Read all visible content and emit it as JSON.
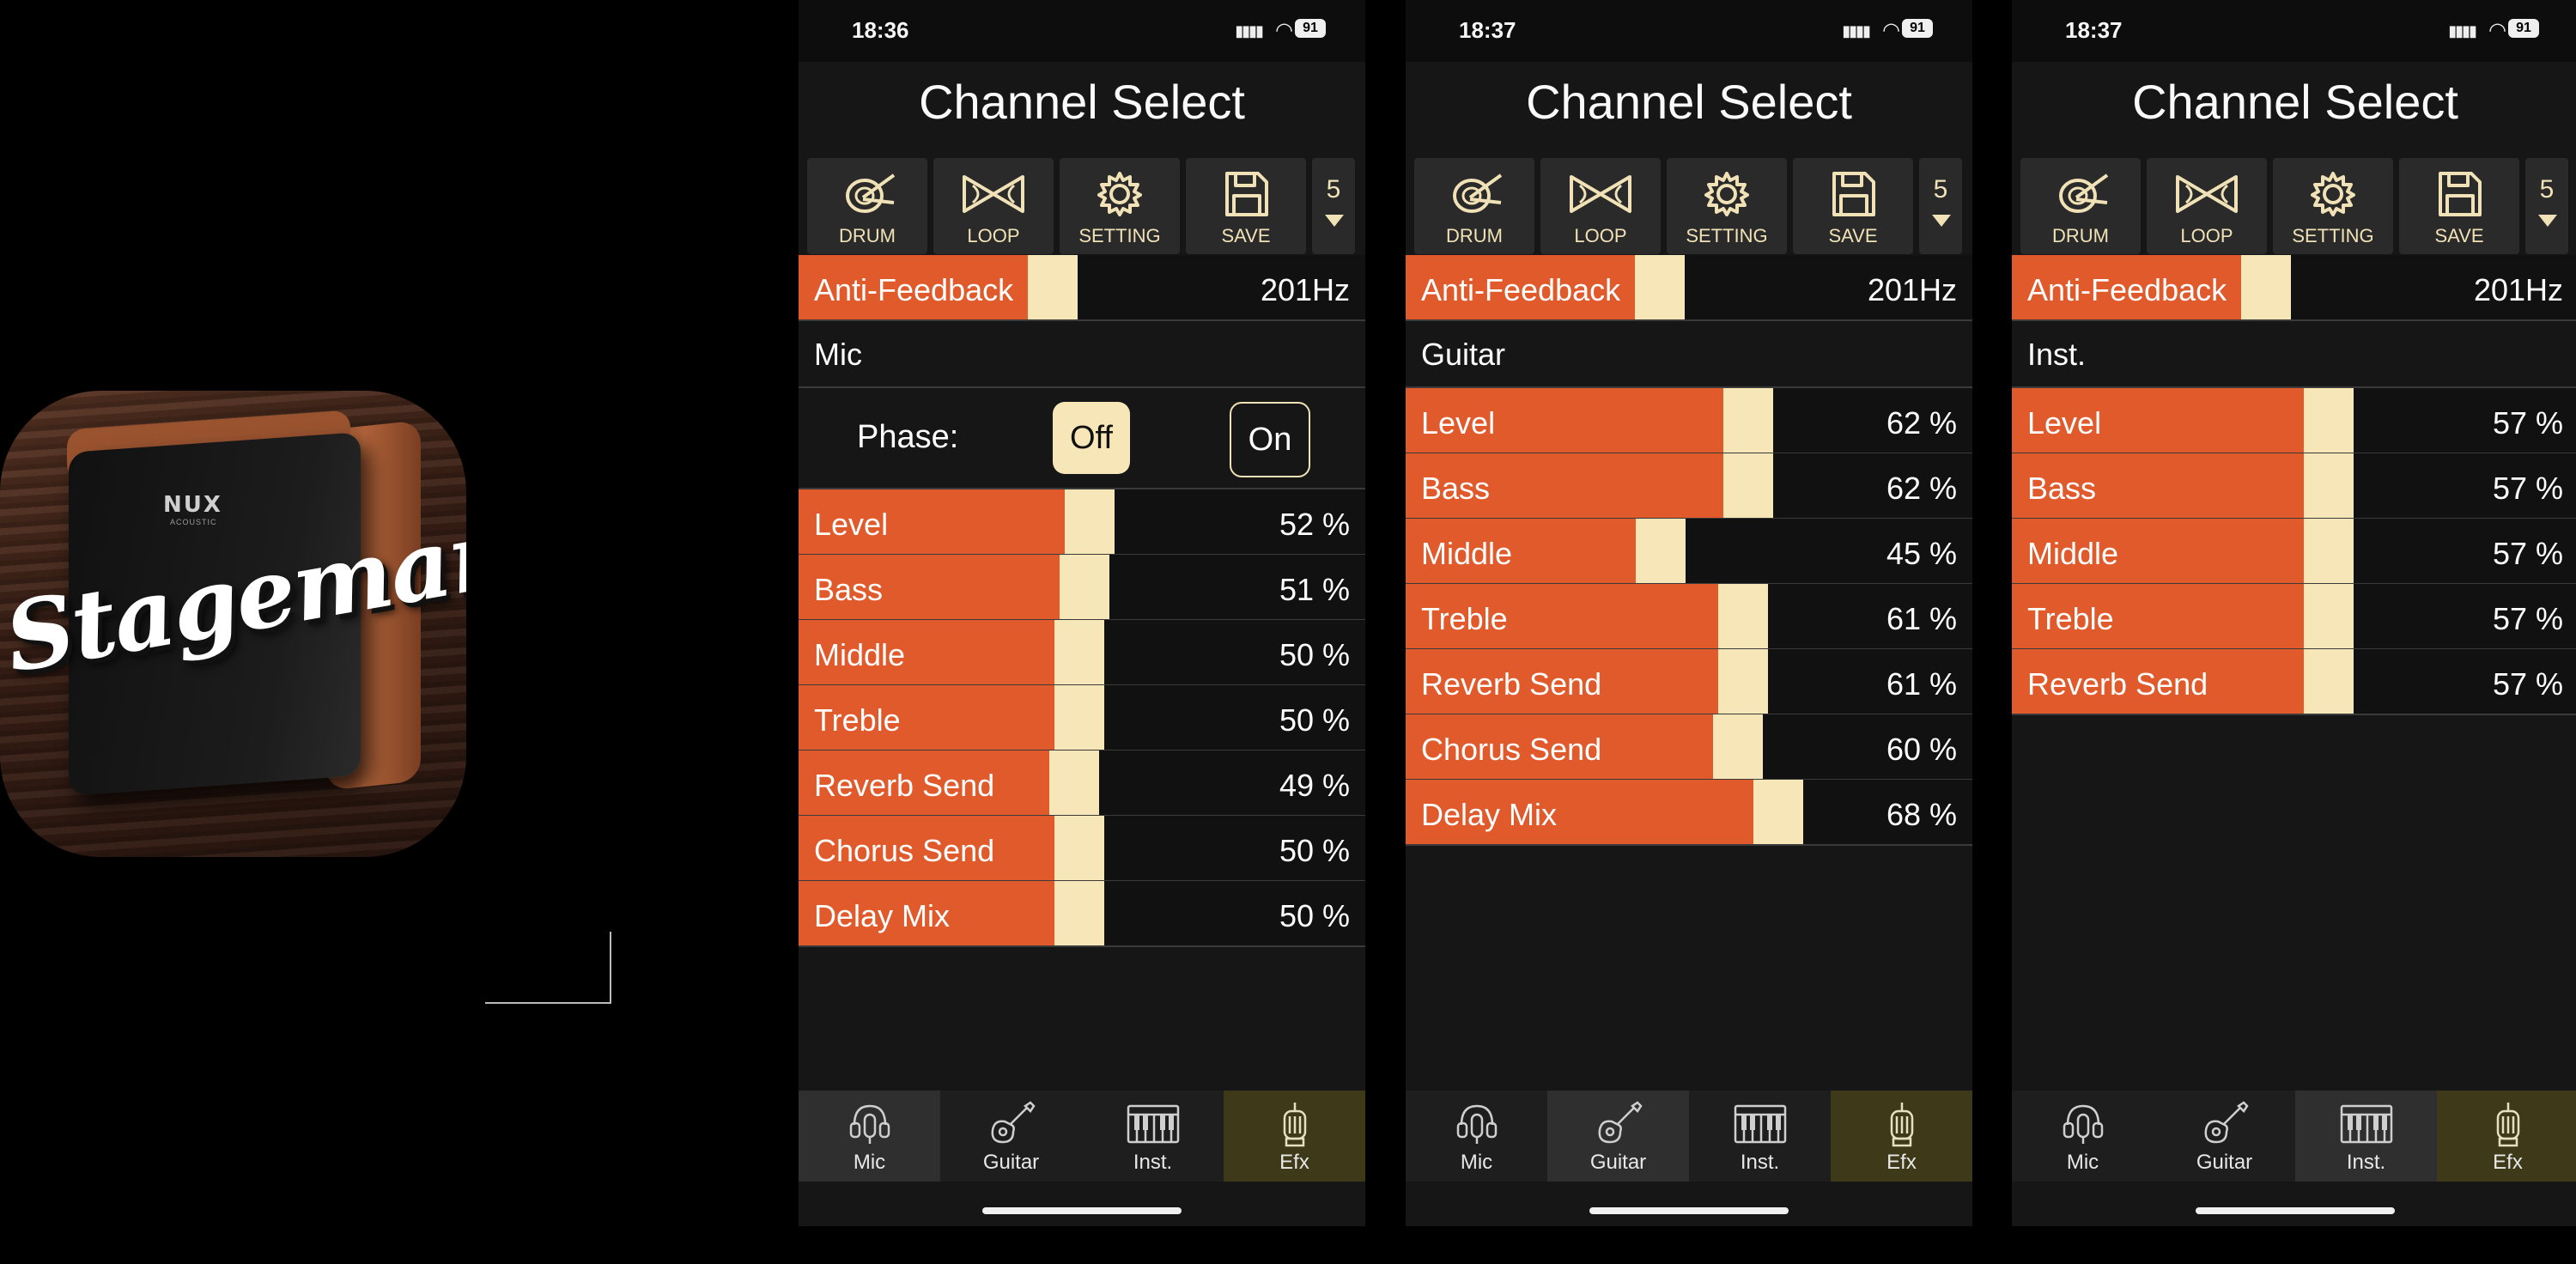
{
  "app_icon": {
    "brand": "NUX",
    "brand_sub": "ACOUSTIC",
    "wordmark": "Stageman"
  },
  "colors": {
    "accent": "#e05a2b",
    "thumb": "#f7e6b8",
    "label_cream": "#f0e2b6",
    "background": "#161616",
    "efx_tab": "#3e3a19"
  },
  "screens": [
    {
      "status": {
        "time": "18:36",
        "battery": "91"
      },
      "title": "Channel Select",
      "toolbar": {
        "drum": "DRUM",
        "loop": "LOOP",
        "setting": "SETTING",
        "save": "SAVE",
        "preset": "5"
      },
      "anti_feedback": {
        "label": "Anti-Feedback",
        "value": "201Hz",
        "level": 0.45
      },
      "channel_label": "Mic",
      "phase": {
        "label": "Phase:",
        "off": "Off",
        "on": "On",
        "selected": "Off"
      },
      "params": [
        {
          "name": "Level",
          "value": "52 %",
          "level": 52
        },
        {
          "name": "Bass",
          "value": "51 %",
          "level": 51
        },
        {
          "name": "Middle",
          "value": "50 %",
          "level": 50
        },
        {
          "name": "Treble",
          "value": "50 %",
          "level": 50
        },
        {
          "name": "Reverb Send",
          "value": "49 %",
          "level": 49
        },
        {
          "name": "Chorus Send",
          "value": "50 %",
          "level": 50
        },
        {
          "name": "Delay Mix",
          "value": "50 %",
          "level": 50
        }
      ],
      "tabs": {
        "mic": "Mic",
        "guitar": "Guitar",
        "inst": "Inst.",
        "efx": "Efx",
        "active": "mic"
      }
    },
    {
      "status": {
        "time": "18:37",
        "battery": "91"
      },
      "title": "Channel Select",
      "toolbar": {
        "drum": "DRUM",
        "loop": "LOOP",
        "setting": "SETTING",
        "save": "SAVE",
        "preset": "5"
      },
      "anti_feedback": {
        "label": "Anti-Feedback",
        "value": "201Hz",
        "level": 0.45
      },
      "channel_label": "Guitar",
      "params": [
        {
          "name": "Level",
          "value": "62 %",
          "level": 62
        },
        {
          "name": "Bass",
          "value": "62 %",
          "level": 62
        },
        {
          "name": "Middle",
          "value": "45 %",
          "level": 45
        },
        {
          "name": "Treble",
          "value": "61 %",
          "level": 61
        },
        {
          "name": "Reverb Send",
          "value": "61 %",
          "level": 61
        },
        {
          "name": "Chorus Send",
          "value": "60 %",
          "level": 60
        },
        {
          "name": "Delay Mix",
          "value": "68 %",
          "level": 68
        }
      ],
      "tabs": {
        "mic": "Mic",
        "guitar": "Guitar",
        "inst": "Inst.",
        "efx": "Efx",
        "active": "guitar"
      }
    },
    {
      "status": {
        "time": "18:37",
        "battery": "91"
      },
      "title": "Channel Select",
      "toolbar": {
        "drum": "DRUM",
        "loop": "LOOP",
        "setting": "SETTING",
        "save": "SAVE",
        "preset": "5"
      },
      "anti_feedback": {
        "label": "Anti-Feedback",
        "value": "201Hz",
        "level": 0.45
      },
      "channel_label": "Inst.",
      "params": [
        {
          "name": "Level",
          "value": "57 %",
          "level": 57
        },
        {
          "name": "Bass",
          "value": "57 %",
          "level": 57
        },
        {
          "name": "Middle",
          "value": "57 %",
          "level": 57
        },
        {
          "name": "Treble",
          "value": "57 %",
          "level": 57
        },
        {
          "name": "Reverb Send",
          "value": "57 %",
          "level": 57
        }
      ],
      "tabs": {
        "mic": "Mic",
        "guitar": "Guitar",
        "inst": "Inst.",
        "efx": "Efx",
        "active": "inst"
      }
    }
  ]
}
